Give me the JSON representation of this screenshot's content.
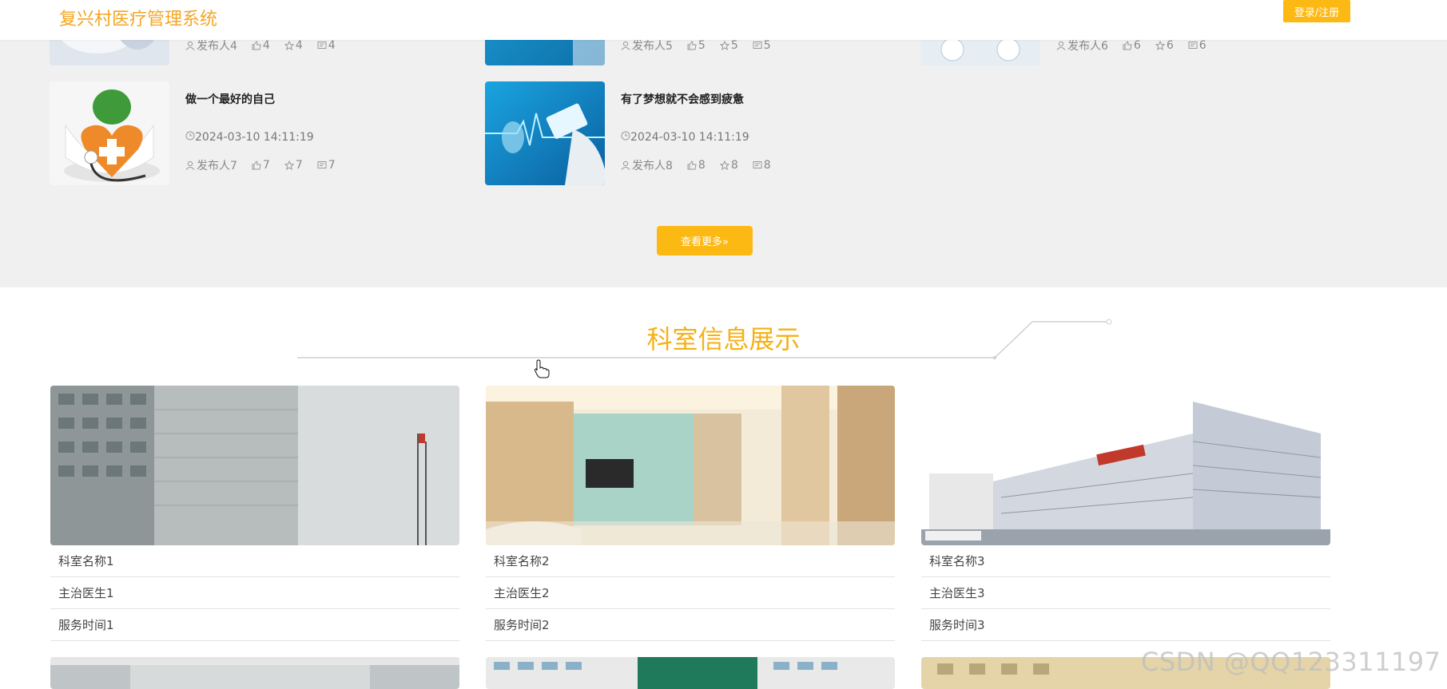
{
  "header": {
    "title": "复兴村医疗管理系统",
    "login_label": "登录/注册"
  },
  "news": {
    "partial_row": [
      {
        "publisher": "发布人4",
        "likes": "4",
        "favorites": "4",
        "comments": "4"
      },
      {
        "publisher": "发布人5",
        "likes": "5",
        "favorites": "5",
        "comments": "5"
      },
      {
        "publisher": "发布人6",
        "likes": "6",
        "favorites": "6",
        "comments": "6"
      }
    ],
    "items": [
      {
        "title": "做一个最好的自己",
        "time": "2024-03-10 14:11:19",
        "publisher": "发布人7",
        "likes": "7",
        "favorites": "7",
        "comments": "7"
      },
      {
        "title": "有了梦想就不会感到疲惫",
        "time": "2024-03-10 14:11:19",
        "publisher": "发布人8",
        "likes": "8",
        "favorites": "8",
        "comments": "8"
      }
    ],
    "more_label": "查看更多»"
  },
  "departments": {
    "title": "科室信息展示",
    "cards": [
      {
        "name": "科室名称1",
        "doctor": "主治医生1",
        "hours": "服务时间1"
      },
      {
        "name": "科室名称2",
        "doctor": "主治医生2",
        "hours": "服务时间2"
      },
      {
        "name": "科室名称3",
        "doctor": "主治医生3",
        "hours": "服务时间3"
      }
    ]
  },
  "watermark": "CSDN @QQ123311197",
  "colors": {
    "accent": "#fdb913",
    "title": "#f5b115",
    "background": "#f0f0f0"
  },
  "icons": [
    "user-icon",
    "thumbs-up-icon",
    "star-icon",
    "comment-icon",
    "clock-icon"
  ]
}
